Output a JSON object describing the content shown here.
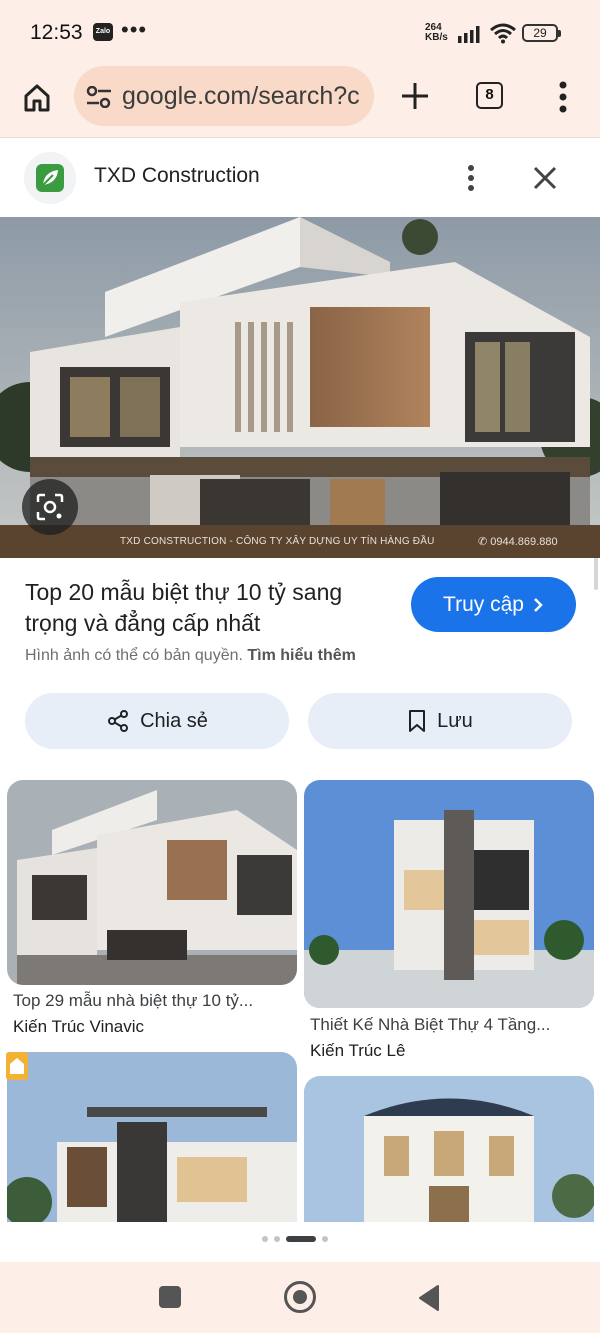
{
  "status_bar": {
    "time": "12:53",
    "app_badge": "Zalo",
    "more": "•••",
    "net_speed_value": "264",
    "net_speed_unit": "KB/s",
    "battery": "29"
  },
  "browser": {
    "url": "google.com/search?c",
    "tab_count": "8"
  },
  "site": {
    "name": "TXD Construction"
  },
  "hero": {
    "caption": "TXD CONSTRUCTION - CÔNG TY XÂY DỰNG UY TÍN HÀNG ĐẦU",
    "phone": "0944.869.880"
  },
  "result": {
    "title": "Top 20 mẫu biệt thự 10 tỷ sang trọng và đẳng cấp nhất",
    "visit_label": "Truy cập",
    "copyright_text": "Hình ảnh có thể có bản quyền.",
    "learn_more": "Tìm hiểu thêm"
  },
  "actions": {
    "share_label": "Chia sẻ",
    "save_label": "Lưu"
  },
  "related": [
    {
      "title": "Top 29 mẫu nhà biệt thự 10 tỷ...",
      "source": "Kiến Trúc Vinavic"
    },
    {
      "title": "Thiết Kế Nhà Biệt Thự 4 Tầng...",
      "source": "Kiến Trúc Lê"
    }
  ],
  "colors": {
    "accent": "#1a73e8",
    "chrome_bg": "#fdefe7",
    "url_bg": "#f9d9c8",
    "chip_bg": "#e8eef8"
  }
}
